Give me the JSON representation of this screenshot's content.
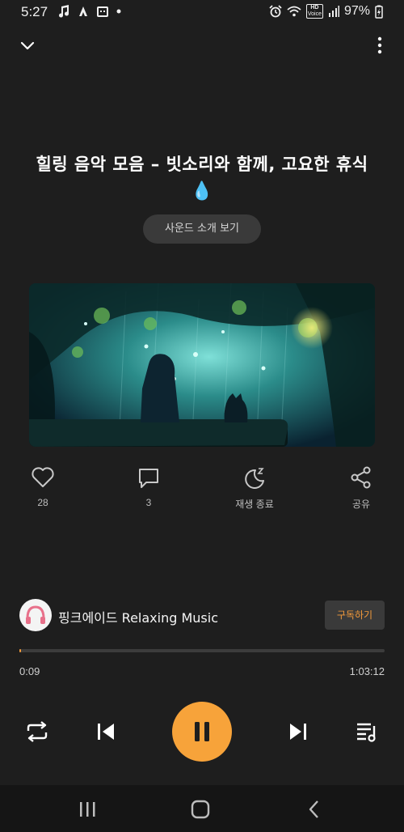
{
  "status_bar": {
    "time": "5:27",
    "battery": "97%",
    "hd_label": "HD",
    "voice_label": "Voice"
  },
  "track": {
    "title_line1": "힐링 음악 모음 – 빗소리와 함께, 고요한 휴식",
    "title_emoji": "💧",
    "sound_intro_label": "사운드 소개 보기"
  },
  "actions": {
    "like_count": "28",
    "comment_count": "3",
    "sleep_timer_label": "재생 종료",
    "share_label": "공유"
  },
  "channel": {
    "name": "핑크에이드 Relaxing Music",
    "subscribe_label": "구독하기"
  },
  "playback": {
    "elapsed": "0:09",
    "total": "1:03:12",
    "progress_fraction": 0.0024
  },
  "colors": {
    "accent": "#f7a33a",
    "background": "#1e1e1e"
  },
  "icons": {
    "collapse": "chevron-down-icon",
    "more": "more-vertical-icon",
    "like": "heart-icon",
    "comment": "comment-icon",
    "sleep": "moon-sleep-icon",
    "share": "share-icon",
    "repeat": "repeat-icon",
    "previous": "skip-previous-icon",
    "pause": "pause-icon",
    "next": "skip-next-icon",
    "queue": "playlist-icon"
  }
}
